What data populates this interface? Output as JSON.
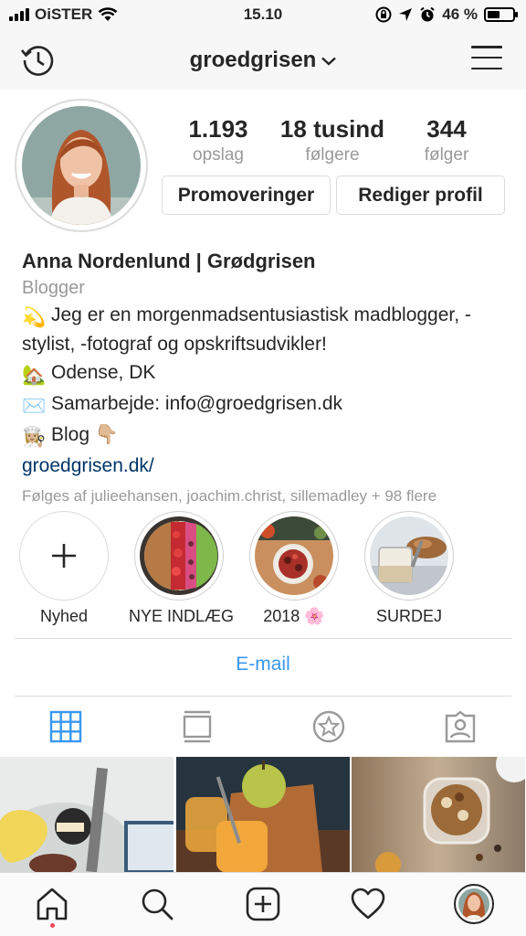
{
  "status_bar": {
    "carrier": "OiSTER",
    "time": "15.10",
    "battery": "46 %"
  },
  "header": {
    "username": "groedgrisen"
  },
  "stats": [
    {
      "value": "1.193",
      "label": "opslag"
    },
    {
      "value": "18 tusind",
      "label": "følgere"
    },
    {
      "value": "344",
      "label": "følger"
    }
  ],
  "buttons": {
    "promote": "Promoveringer",
    "edit": "Rediger profil"
  },
  "bio": {
    "name": "Anna Nordenlund | Grødgrisen",
    "category": "Blogger",
    "lines": [
      {
        "icon": "💫",
        "text": "Jeg er en morgenmadsentusiastisk madblogger, -stylist, -fotograf og opskriftsudvikler!"
      },
      {
        "icon": "🏡",
        "text": "Odense, DK"
      },
      {
        "icon": "✉️",
        "text": "Samarbejde: info@groedgrisen.dk"
      },
      {
        "icon": "👩🏼‍🍳",
        "text": "Blog 👇🏼"
      }
    ],
    "link": "groedgrisen.dk/",
    "followed_by": "Følges af julieehansen, joachim.christ, sillemadley + 98 flere"
  },
  "highlights": [
    {
      "label": "Nyhed"
    },
    {
      "label": "NYE INDLÆG"
    },
    {
      "label": "2018 🌸"
    },
    {
      "label": "SURDEJ"
    }
  ],
  "contact": {
    "email": "E-mail"
  },
  "colors": {
    "link": "#003569",
    "accent": "#3897f0",
    "secondary_text": "#999999",
    "border": "#dbdbdb",
    "notification": "#ed4956"
  },
  "icons": {
    "tabs": [
      "grid-icon",
      "feed-icon",
      "saved-star-icon",
      "tagged-icon"
    ],
    "bottom": [
      "home-icon",
      "search-icon",
      "add-post-icon",
      "heart-icon",
      "profile-avatar"
    ]
  }
}
